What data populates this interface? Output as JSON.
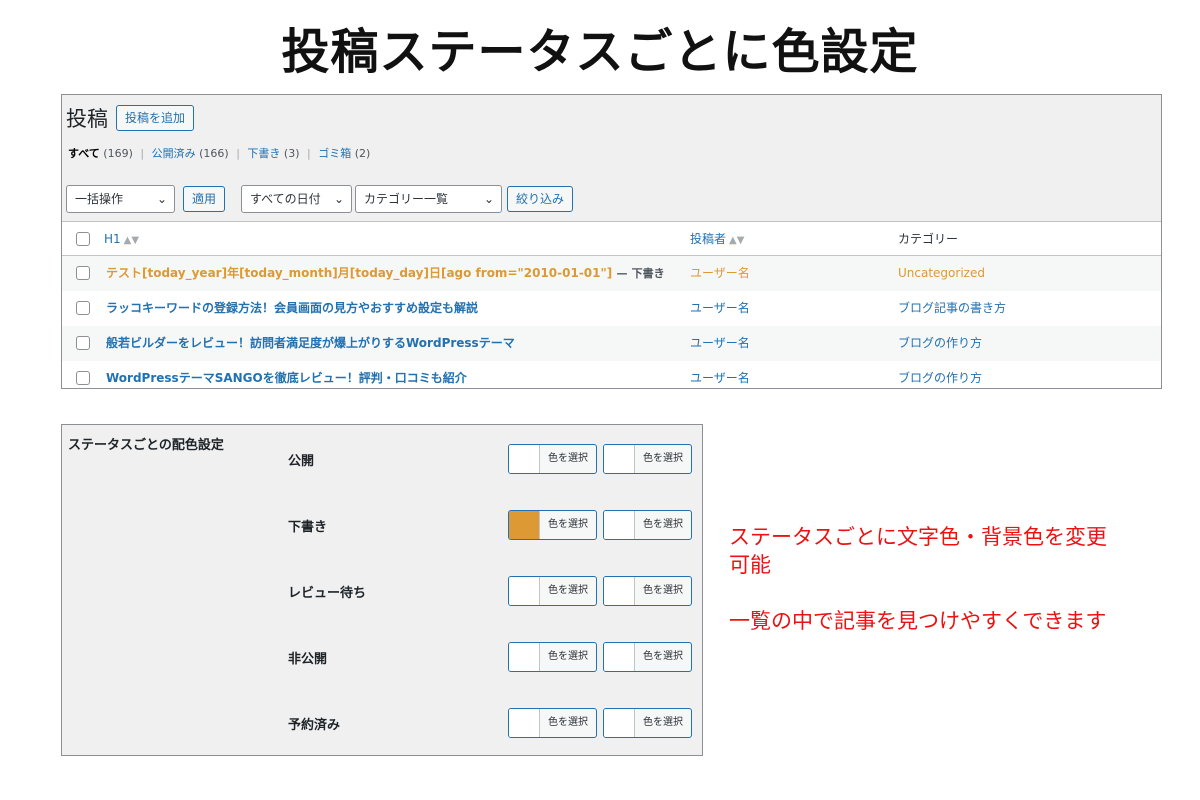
{
  "title": "投稿ステータスごとに色設定",
  "posts_panel": {
    "heading": "投稿",
    "add_new": "投稿を追加",
    "views": [
      {
        "label": "すべて",
        "count": "(169)"
      },
      {
        "label": "公開済み",
        "count": "(166)"
      },
      {
        "label": "下書き",
        "count": "(3)"
      },
      {
        "label": "ゴミ箱",
        "count": "(2)"
      }
    ],
    "separator": "|",
    "bulk_action": "一括操作",
    "apply": "適用",
    "date_filter": "すべての日付",
    "category_filter": "カテゴリー一覧",
    "filter": "絞り込み",
    "columns": {
      "title": "H1",
      "author": "投稿者",
      "category": "カテゴリー"
    },
    "rows": [
      {
        "title": "テスト[today_year]年[today_month]月[today_day]日[ago from=\"2010-01-01\"]",
        "state_sep": "—",
        "state": "下書き",
        "author": "ユーザー名",
        "category": "Uncategorized"
      },
      {
        "title": "ラッコキーワードの登録方法！会員画面の見方やおすすめ設定も解説",
        "author": "ユーザー名",
        "category": "ブログ記事の書き方"
      },
      {
        "title": "般若ビルダーをレビュー！訪問者満足度が爆上がりするWordPressテーマ",
        "author": "ユーザー名",
        "category": "ブログの作り方"
      },
      {
        "title": "WordPressテーマSANGOを徹底レビュー！評判・口コミも紹介",
        "author": "ユーザー名",
        "category": "ブログの作り方"
      }
    ]
  },
  "status_panel": {
    "heading": "ステータスごとの配色設定",
    "button_label": "色を選択",
    "statuses": [
      {
        "label": "公開",
        "text_color": "",
        "bg_color": ""
      },
      {
        "label": "下書き",
        "text_color": "#dd9933",
        "bg_color": ""
      },
      {
        "label": "レビュー待ち",
        "text_color": "",
        "bg_color": ""
      },
      {
        "label": "非公開",
        "text_color": "",
        "bg_color": ""
      },
      {
        "label": "予約済み",
        "text_color": "",
        "bg_color": ""
      }
    ]
  },
  "annotation": {
    "line1": "ステータスごとに文字色・背景色を変更",
    "line2": "可能",
    "line3": "一覧の中で記事を見つけやすくできます"
  },
  "colors": {
    "accent": "#2271b1",
    "draft": "#dd9933",
    "annotation": "#ee1111"
  }
}
